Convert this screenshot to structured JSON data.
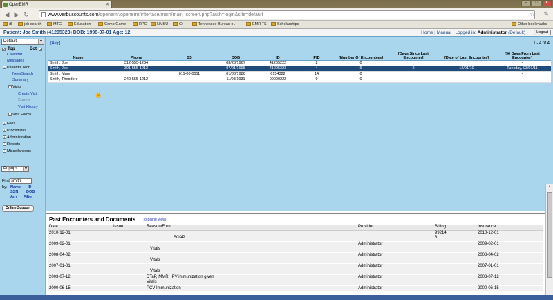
{
  "browser": {
    "tab_title": "OpenEMR",
    "url_domain": "www.verbuscounts.com",
    "url_path": "/openemr/openemr/interface/main/main_screen.php?auth=login&site=default",
    "bookmarks": [
      "dl",
      "job search",
      "MTG",
      "Education",
      "Comp Game",
      "RPG",
      "NMSU",
      "C++",
      "Tennessee Bureau o...",
      "EMR TS",
      "Scholarships"
    ],
    "other_bookmarks": "Other bookmarks"
  },
  "header": {
    "patient_label": "Patient: Joe Smith (41205323) DOB: 1998-07-01 Age: 12",
    "home": "Home",
    "manual": "Manual",
    "logged_in": "Logged in:",
    "user": "Administrator",
    "site": "(Default)",
    "logout": "Logout"
  },
  "sidebar": {
    "layout_select": "Default",
    "top_label": "Top",
    "bot_label": "Bot",
    "calendar": "Calendar",
    "messages": "Messages",
    "patient_client": "Patient/Client",
    "new_search": "New/Search",
    "summary": "Summary",
    "visits": "Visits",
    "create_visit": "Create Visit",
    "current": "Current",
    "visit_history": "Visit History",
    "visit_forms": "Visit Forms",
    "fees": "Fees",
    "procedures": "Procedures",
    "administration": "Administration",
    "reports": "Reports",
    "miscellaneous": "Miscellaneous",
    "popups": "Popups",
    "find_label": "Find:",
    "find_value": "smith",
    "by_label": "by:",
    "by_name": "Name",
    "by_id": "ID",
    "by_ssn": "SSN",
    "by_dob": "DOB",
    "by_any": "Any",
    "by_filter": "Filter",
    "online_support": "Online Support"
  },
  "search": {
    "help": "[Help]",
    "count": "1 - 4 of 4",
    "columns": [
      "Name",
      "Phone",
      "SS",
      "DOB",
      "ID",
      "PID",
      "[Number Of Encounters]",
      "[Days Since Last Encounter]",
      "[Date of Last Encounter]",
      "[90 Days From Last Encounter]"
    ],
    "rows": [
      [
        "Smith, Joe",
        "312-555-1234",
        "",
        "03/23/1967",
        "41205222",
        "2",
        "0",
        "",
        "",
        "-"
      ],
      [
        "Smith, Joe",
        "301-555-1212",
        "",
        "07/01/1998",
        "41205323",
        "4",
        "6",
        "2",
        "12/01/10",
        "Tuesday, 03/01/11"
      ],
      [
        "Smith, Mary",
        "",
        "011-00-0011",
        "01/06/1986",
        "6154322",
        "14",
        "0",
        "",
        "",
        "-"
      ],
      [
        "Smith, Theodore",
        "240-555-1212",
        "",
        "11/08/1931",
        "00000222",
        "9",
        "0",
        "",
        "",
        "-"
      ]
    ],
    "highlighted_row": 1
  },
  "encounters": {
    "title": "Past Encounters and Documents",
    "billing_view": "(To Billing View)",
    "columns": [
      "Date",
      "Issue",
      "Reason/Form",
      "Provider",
      "Billing",
      "Insurance"
    ],
    "rows": [
      {
        "date": "2010-12-01",
        "issue": "",
        "reason": "",
        "form": "SOAP",
        "provider": "",
        "billing": "99214",
        "billing2": "3",
        "insurance": "2010-12-01"
      },
      {
        "date": "2009-02-01",
        "issue": "",
        "reason": "",
        "form": "Vitals",
        "provider": "Administrator",
        "billing": "",
        "billing2": "",
        "insurance": "2009-02-01"
      },
      {
        "date": "2008-04-02",
        "issue": "",
        "reason": "",
        "form": "Vitals",
        "provider": "Administrator",
        "billing": "",
        "billing2": "",
        "insurance": "2008-04-02"
      },
      {
        "date": "2007-01-01",
        "issue": "",
        "reason": "",
        "form": "Vitals",
        "provider": "Administrator",
        "billing": "",
        "billing2": "",
        "insurance": "2007-01-01"
      },
      {
        "date": "2003-07-12",
        "issue": "",
        "reason": "DTaP, MMR, IPV immunization given",
        "form": "Vitals",
        "provider": "Administrator",
        "billing": "",
        "billing2": "",
        "insurance": "2003-07-12"
      },
      {
        "date": "2000-06-15",
        "issue": "",
        "reason": "PCV Immunization",
        "form": "",
        "provider": "Administrator",
        "billing": "",
        "billing2": "",
        "insurance": "2000-06-15"
      }
    ]
  }
}
